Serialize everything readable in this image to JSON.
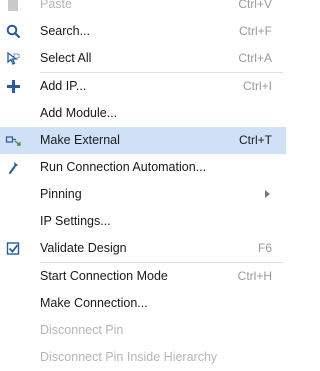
{
  "menu": {
    "items": [
      {
        "label": "Paste",
        "shortcut": "Ctrl+V",
        "icon": "paste-icon"
      },
      {
        "label": "Search...",
        "shortcut": "Ctrl+F",
        "icon": "search-icon"
      },
      {
        "label": "Select All",
        "shortcut": "Ctrl+A",
        "icon": "select-all-icon"
      },
      {
        "label": "Add IP...",
        "shortcut": "Ctrl+I",
        "icon": "plus-icon"
      },
      {
        "label": "Add Module...",
        "shortcut": ""
      },
      {
        "label": "Make External",
        "shortcut": "Ctrl+T",
        "icon": "make-external-icon"
      },
      {
        "label": "Run Connection Automation...",
        "shortcut": "",
        "icon": "wand-icon"
      },
      {
        "label": "Pinning",
        "shortcut": ""
      },
      {
        "label": "IP Settings...",
        "shortcut": ""
      },
      {
        "label": "Validate Design",
        "shortcut": "F6",
        "icon": "checkbox-icon"
      },
      {
        "label": "Start Connection Mode",
        "shortcut": "Ctrl+H"
      },
      {
        "label": "Make Connection...",
        "shortcut": ""
      },
      {
        "label": "Disconnect Pin",
        "shortcut": ""
      },
      {
        "label": "Disconnect Pin Inside Hierarchy",
        "shortcut": ""
      }
    ]
  },
  "colors": {
    "highlight": "#cfe0f7",
    "text": "#1a1a1a",
    "disabled_text": "#b5b5b5",
    "shortcut_text": "#9a9a9a",
    "icon_blue": "#2a5b9a"
  }
}
